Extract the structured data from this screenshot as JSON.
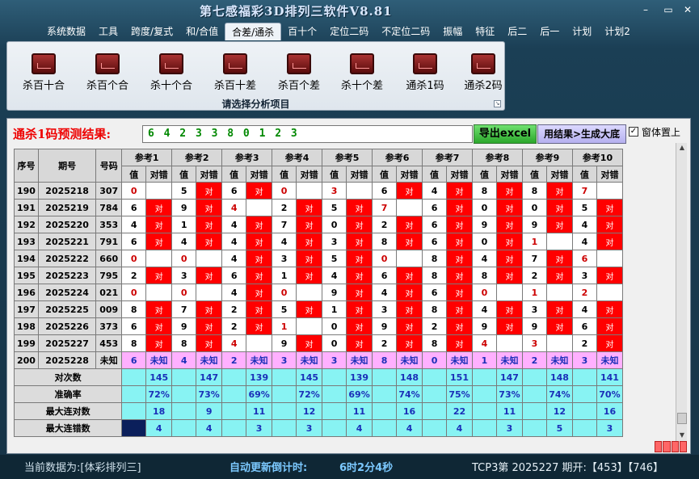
{
  "window": {
    "title": "第七感福彩3D排列三软件V8.81",
    "min": "–",
    "restore": "▭",
    "close": "✕"
  },
  "menu": [
    "系统数据",
    "工具",
    "跨度/复式",
    "和/合值",
    "合差/通杀",
    "百十个",
    "定位二码",
    "不定位二码",
    "振幅",
    "特征",
    "后二",
    "后一",
    "计划",
    "计划2"
  ],
  "menu_active_index": 4,
  "ribbon": {
    "buttons": [
      "杀百十合",
      "杀百个合",
      "杀十个合",
      "杀百十差",
      "杀百个差",
      "杀十个差",
      "通杀1码",
      "通杀2码"
    ],
    "icon": "chart-icon",
    "caption": "请选择分析项目"
  },
  "prediction": {
    "label": "通杀1码预测结果:",
    "value": "6 4 2 3 3 8 0 1 2 3"
  },
  "buttons": {
    "excel": "导出excel",
    "generate": "用结果>生成大底"
  },
  "checkbox": {
    "checked": "✓",
    "label": "窗体置上"
  },
  "table": {
    "h_seq": "序号",
    "h_period": "期号",
    "h_num": "号码",
    "refs": [
      "参考1",
      "参考2",
      "参考3",
      "参考4",
      "参考5",
      "参考6",
      "参考7",
      "参考8",
      "参考9",
      "参考10"
    ],
    "sub_val": "值",
    "sub_hit": "对错",
    "hit_text": "对",
    "unknown_text": "未知",
    "rows": [
      {
        "seq": "190",
        "period": "2025218",
        "num": "307",
        "vals": [
          "0",
          "5",
          "6",
          "0",
          "3",
          "6",
          "4",
          "8",
          "8",
          "7"
        ],
        "hits": [
          0,
          1,
          1,
          0,
          0,
          1,
          1,
          1,
          1,
          0
        ]
      },
      {
        "seq": "191",
        "period": "2025219",
        "num": "784",
        "vals": [
          "6",
          "9",
          "4",
          "2",
          "5",
          "7",
          "6",
          "0",
          "0",
          "5"
        ],
        "hits": [
          1,
          1,
          0,
          1,
          1,
          0,
          1,
          1,
          1,
          1
        ]
      },
      {
        "seq": "192",
        "period": "2025220",
        "num": "353",
        "vals": [
          "4",
          "1",
          "4",
          "7",
          "0",
          "2",
          "6",
          "9",
          "9",
          "4"
        ],
        "hits": [
          1,
          1,
          1,
          1,
          1,
          1,
          1,
          1,
          1,
          1
        ]
      },
      {
        "seq": "193",
        "period": "2025221",
        "num": "791",
        "vals": [
          "6",
          "4",
          "4",
          "4",
          "3",
          "8",
          "6",
          "0",
          "1",
          "4"
        ],
        "hits": [
          1,
          1,
          1,
          1,
          1,
          1,
          1,
          1,
          0,
          1
        ]
      },
      {
        "seq": "194",
        "period": "2025222",
        "num": "660",
        "vals": [
          "0",
          "0",
          "4",
          "3",
          "5",
          "0",
          "8",
          "4",
          "7",
          "6"
        ],
        "hits": [
          0,
          0,
          1,
          1,
          1,
          0,
          1,
          1,
          1,
          0
        ]
      },
      {
        "seq": "195",
        "period": "2025223",
        "num": "795",
        "vals": [
          "2",
          "3",
          "6",
          "1",
          "4",
          "6",
          "8",
          "8",
          "2",
          "3"
        ],
        "hits": [
          1,
          1,
          1,
          1,
          1,
          1,
          1,
          1,
          1,
          1
        ]
      },
      {
        "seq": "196",
        "period": "2025224",
        "num": "021",
        "vals": [
          "0",
          "0",
          "4",
          "0",
          "9",
          "4",
          "6",
          "0",
          "1",
          "2"
        ],
        "hits": [
          0,
          0,
          1,
          0,
          1,
          1,
          1,
          0,
          0,
          0
        ]
      },
      {
        "seq": "197",
        "period": "2025225",
        "num": "009",
        "vals": [
          "8",
          "7",
          "2",
          "5",
          "1",
          "3",
          "8",
          "4",
          "3",
          "4"
        ],
        "hits": [
          1,
          1,
          1,
          1,
          1,
          1,
          1,
          1,
          1,
          1
        ]
      },
      {
        "seq": "198",
        "period": "2025226",
        "num": "373",
        "vals": [
          "6",
          "9",
          "2",
          "1",
          "0",
          "9",
          "2",
          "9",
          "9",
          "6"
        ],
        "hits": [
          1,
          1,
          1,
          0,
          1,
          1,
          1,
          1,
          1,
          1
        ]
      },
      {
        "seq": "199",
        "period": "2025227",
        "num": "453",
        "vals": [
          "8",
          "8",
          "4",
          "9",
          "0",
          "2",
          "8",
          "4",
          "3",
          "2"
        ],
        "hits": [
          1,
          1,
          0,
          1,
          1,
          1,
          1,
          0,
          0,
          1
        ]
      }
    ],
    "pending": {
      "seq": "200",
      "period": "2025228",
      "num": "未知",
      "vals": [
        "6",
        "4",
        "2",
        "3",
        "3",
        "8",
        "0",
        "1",
        "2",
        "3"
      ]
    },
    "stats": [
      {
        "label": "对次数",
        "vals": [
          "145",
          "147",
          "139",
          "145",
          "139",
          "148",
          "151",
          "147",
          "148",
          "141"
        ]
      },
      {
        "label": "准确率",
        "vals": [
          "72%",
          "73%",
          "69%",
          "72%",
          "69%",
          "74%",
          "75%",
          "73%",
          "74%",
          "70%"
        ]
      },
      {
        "label": "最大连对数",
        "vals": [
          "18",
          "9",
          "11",
          "12",
          "11",
          "16",
          "22",
          "11",
          "12",
          "16"
        ]
      },
      {
        "label": "最大连错数",
        "vals": [
          "4",
          "4",
          "3",
          "3",
          "4",
          "4",
          "4",
          "3",
          "5",
          "3"
        ]
      }
    ]
  },
  "status": {
    "current": "当前数据为:[体彩排列三]",
    "countdown_label": "自动更新倒计时:",
    "countdown": "6时2分4秒",
    "draw": "TCP3第 2025227 期开:【453】【746】"
  }
}
